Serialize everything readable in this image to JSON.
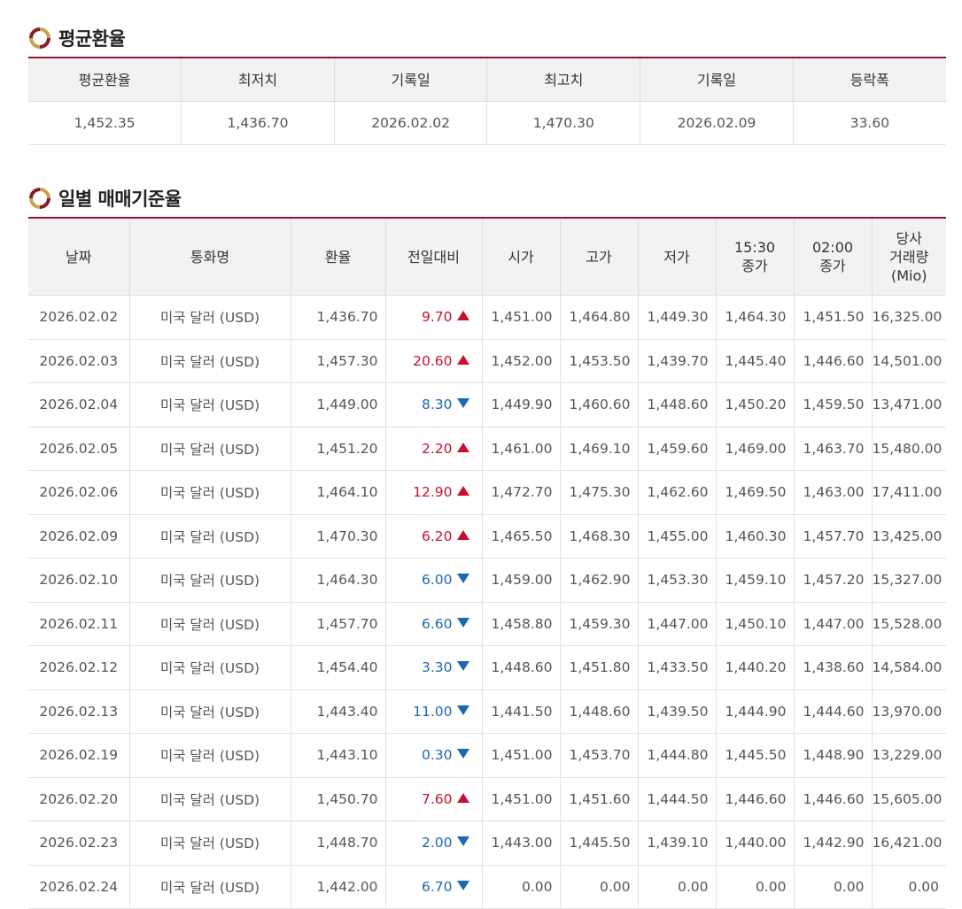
{
  "avg_section": {
    "title": "평균환율",
    "headers": [
      "평균환율",
      "최저치",
      "기록일",
      "최고치",
      "기록일",
      "등락폭"
    ],
    "values": [
      "1,452.35",
      "1,436.70",
      "2026.02.02",
      "1,470.30",
      "2026.02.09",
      "33.60"
    ]
  },
  "daily_section": {
    "title": "일별 매매기준율",
    "headers": {
      "date": "날짜",
      "currency": "통화명",
      "rate": "환율",
      "change": "전일대비",
      "open": "시가",
      "high": "고가",
      "low": "저가",
      "close1530_line1": "15:30",
      "close1530_line2": "종가",
      "close0200_line1": "02:00",
      "close0200_line2": "종가",
      "volume_line1": "당사",
      "volume_line2": "거래량",
      "volume_line3": "(Mio)"
    },
    "rows": [
      {
        "date": "2026.02.02",
        "currency": "미국 달러 (USD)",
        "rate": "1,436.70",
        "change": "9.70",
        "dir": "up",
        "open": "1,451.00",
        "high": "1,464.80",
        "low": "1,449.30",
        "c1530": "1,464.30",
        "c0200": "1,451.50",
        "vol": "16,325.00"
      },
      {
        "date": "2026.02.03",
        "currency": "미국 달러 (USD)",
        "rate": "1,457.30",
        "change": "20.60",
        "dir": "up",
        "open": "1,452.00",
        "high": "1,453.50",
        "low": "1,439.70",
        "c1530": "1,445.40",
        "c0200": "1,446.60",
        "vol": "14,501.00"
      },
      {
        "date": "2026.02.04",
        "currency": "미국 달러 (USD)",
        "rate": "1,449.00",
        "change": "8.30",
        "dir": "down",
        "open": "1,449.90",
        "high": "1,460.60",
        "low": "1,448.60",
        "c1530": "1,450.20",
        "c0200": "1,459.50",
        "vol": "13,471.00"
      },
      {
        "date": "2026.02.05",
        "currency": "미국 달러 (USD)",
        "rate": "1,451.20",
        "change": "2.20",
        "dir": "up",
        "open": "1,461.00",
        "high": "1,469.10",
        "low": "1,459.60",
        "c1530": "1,469.00",
        "c0200": "1,463.70",
        "vol": "15,480.00"
      },
      {
        "date": "2026.02.06",
        "currency": "미국 달러 (USD)",
        "rate": "1,464.10",
        "change": "12.90",
        "dir": "up",
        "open": "1,472.70",
        "high": "1,475.30",
        "low": "1,462.60",
        "c1530": "1,469.50",
        "c0200": "1,463.00",
        "vol": "17,411.00"
      },
      {
        "date": "2026.02.09",
        "currency": "미국 달러 (USD)",
        "rate": "1,470.30",
        "change": "6.20",
        "dir": "up",
        "open": "1,465.50",
        "high": "1,468.30",
        "low": "1,455.00",
        "c1530": "1,460.30",
        "c0200": "1,457.70",
        "vol": "13,425.00"
      },
      {
        "date": "2026.02.10",
        "currency": "미국 달러 (USD)",
        "rate": "1,464.30",
        "change": "6.00",
        "dir": "down",
        "open": "1,459.00",
        "high": "1,462.90",
        "low": "1,453.30",
        "c1530": "1,459.10",
        "c0200": "1,457.20",
        "vol": "15,327.00"
      },
      {
        "date": "2026.02.11",
        "currency": "미국 달러 (USD)",
        "rate": "1,457.70",
        "change": "6.60",
        "dir": "down",
        "open": "1,458.80",
        "high": "1,459.30",
        "low": "1,447.00",
        "c1530": "1,450.10",
        "c0200": "1,447.00",
        "vol": "15,528.00"
      },
      {
        "date": "2026.02.12",
        "currency": "미국 달러 (USD)",
        "rate": "1,454.40",
        "change": "3.30",
        "dir": "down",
        "open": "1,448.60",
        "high": "1,451.80",
        "low": "1,433.50",
        "c1530": "1,440.20",
        "c0200": "1,438.60",
        "vol": "14,584.00"
      },
      {
        "date": "2026.02.13",
        "currency": "미국 달러 (USD)",
        "rate": "1,443.40",
        "change": "11.00",
        "dir": "down",
        "open": "1,441.50",
        "high": "1,448.60",
        "low": "1,439.50",
        "c1530": "1,444.90",
        "c0200": "1,444.60",
        "vol": "13,970.00"
      },
      {
        "date": "2026.02.19",
        "currency": "미국 달러 (USD)",
        "rate": "1,443.10",
        "change": "0.30",
        "dir": "down",
        "open": "1,451.00",
        "high": "1,453.70",
        "low": "1,444.80",
        "c1530": "1,445.50",
        "c0200": "1,448.90",
        "vol": "13,229.00"
      },
      {
        "date": "2026.02.20",
        "currency": "미국 달러 (USD)",
        "rate": "1,450.70",
        "change": "7.60",
        "dir": "up",
        "open": "1,451.00",
        "high": "1,451.60",
        "low": "1,444.50",
        "c1530": "1,446.60",
        "c0200": "1,446.60",
        "vol": "15,605.00"
      },
      {
        "date": "2026.02.23",
        "currency": "미국 달러 (USD)",
        "rate": "1,448.70",
        "change": "2.00",
        "dir": "down",
        "open": "1,443.00",
        "high": "1,445.50",
        "low": "1,439.10",
        "c1530": "1,440.00",
        "c0200": "1,442.90",
        "vol": "16,421.00"
      },
      {
        "date": "2026.02.24",
        "currency": "미국 달러 (USD)",
        "rate": "1,442.00",
        "change": "6.70",
        "dir": "down",
        "open": "0.00",
        "high": "0.00",
        "low": "0.00",
        "c1530": "0.00",
        "c0200": "0.00",
        "vol": "0.00"
      }
    ]
  },
  "colors": {
    "accent": "#8b1a2c",
    "logo_gold": "#c8a24a",
    "up": "#c8102e",
    "down": "#1b67b3",
    "header_bg": "#f2f2f2"
  },
  "icons": {
    "section_logo": "ring-logo-icon",
    "up": "triangle-up-icon",
    "down": "triangle-down-icon"
  }
}
